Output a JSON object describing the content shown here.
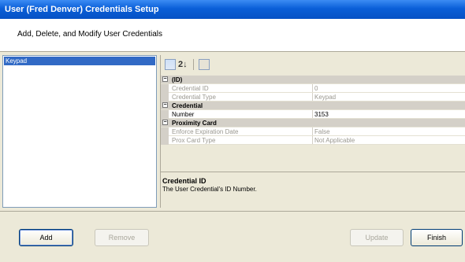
{
  "window": {
    "title": "User (Fred Denver) Credentials Setup"
  },
  "header": {
    "text": "Add, Delete, and Modify User Credentials"
  },
  "credential_list": {
    "items": [
      {
        "label": "Keypad",
        "selected": true
      }
    ]
  },
  "toolbar": {
    "icons": [
      "categorized-icon",
      "alphabetical-icon",
      "property-pages-icon"
    ],
    "alphabetical_glyph": "2↓"
  },
  "property_grid": {
    "categories": [
      {
        "label": "(ID)",
        "properties": [
          {
            "name": "Credential ID",
            "value": "0",
            "enabled": false
          },
          {
            "name": "Credential Type",
            "value": "Keypad",
            "enabled": false
          }
        ]
      },
      {
        "label": "Credential",
        "properties": [
          {
            "name": "Number",
            "value": "3153",
            "enabled": true
          }
        ]
      },
      {
        "label": "Proximity Card",
        "properties": [
          {
            "name": "Enforce Expiration Date",
            "value": "False",
            "enabled": false
          },
          {
            "name": "Prox Card Type",
            "value": "Not Applicable",
            "enabled": false
          }
        ]
      }
    ],
    "expander_glyph": "−"
  },
  "description": {
    "title": "Credential ID",
    "text": "The User Credential's ID Number."
  },
  "buttons": {
    "add": "Add",
    "remove": "Remove",
    "update": "Update",
    "finish": "Finish"
  }
}
